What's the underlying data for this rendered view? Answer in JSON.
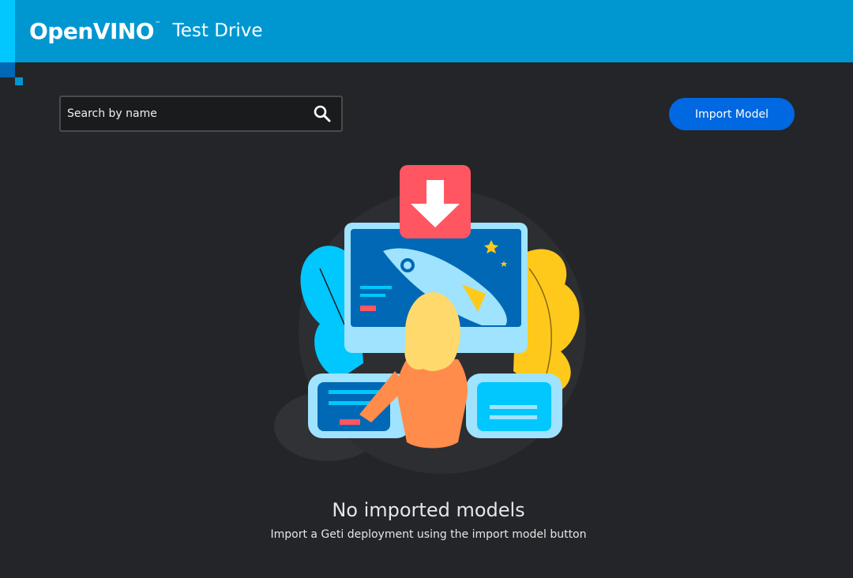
{
  "header": {
    "logo_text": "OpenVINO",
    "logo_trademark": "™",
    "title": "Test Drive"
  },
  "toolbar": {
    "search": {
      "placeholder": "Search by name",
      "value": "",
      "icon": "search-icon"
    },
    "import_button_label": "Import Model"
  },
  "empty_state": {
    "illustration": "download-model-illustration",
    "title": "No imported models",
    "subtitle": "Import a Geti deployment using the import model button"
  },
  "colors": {
    "header_background": "#0097D1",
    "page_background": "#242528",
    "primary_button": "#0068E0"
  }
}
